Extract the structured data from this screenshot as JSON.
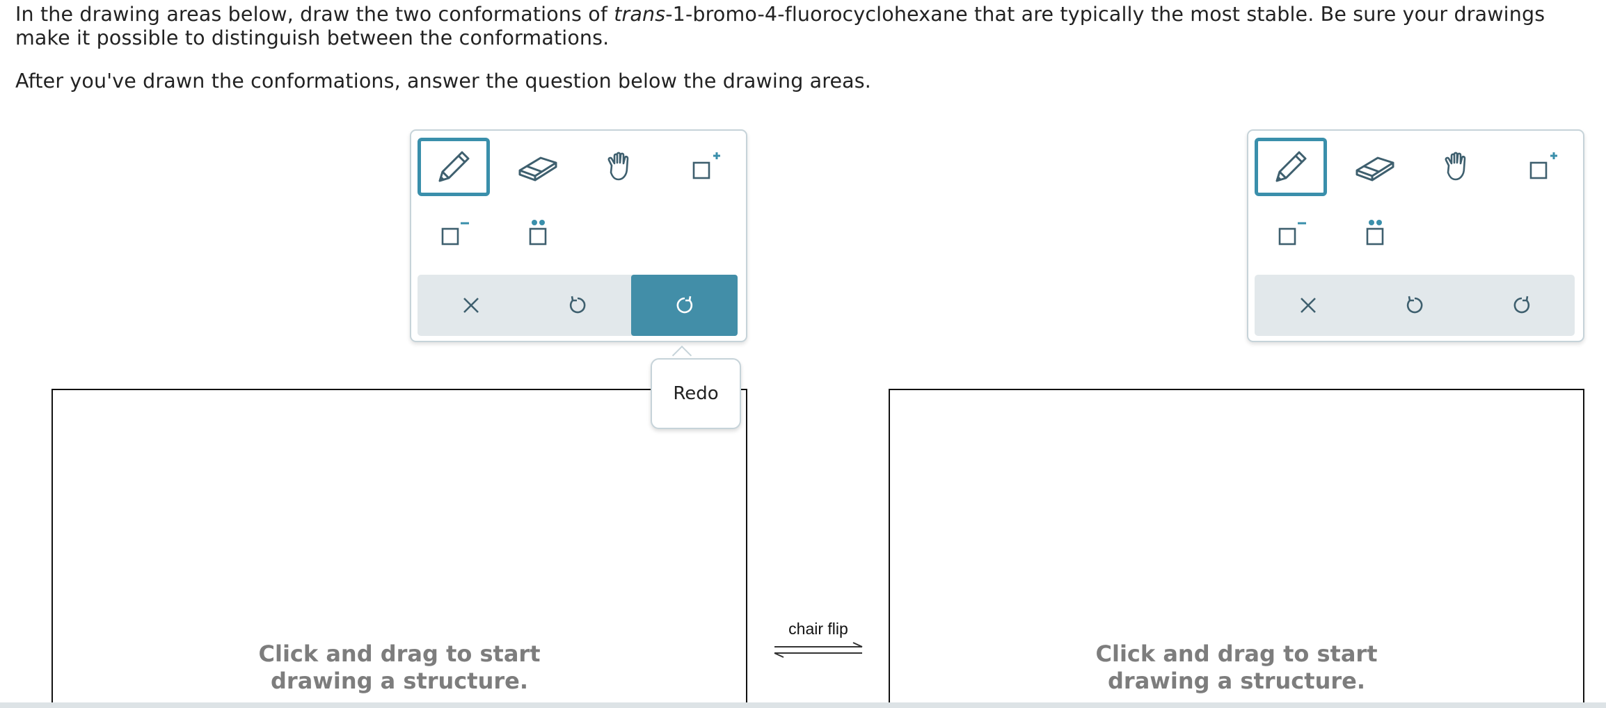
{
  "instructions": {
    "line1_prefix": "In the drawing areas below, draw the two conformations of ",
    "line1_italic": "trans",
    "line1_suffix": "-1-bromo-4-fluorocyclohexane that are typically the most stable. Be sure your drawings make it possible to distinguish between the conformations.",
    "line2": "After you've drawn the conformations, answer the question below the drawing areas."
  },
  "toolbar": {
    "tools": [
      {
        "name": "pencil",
        "icon": "pencil-icon",
        "selected": true
      },
      {
        "name": "eraser",
        "icon": "eraser-icon",
        "selected": false
      },
      {
        "name": "move",
        "icon": "hand-icon",
        "selected": false
      },
      {
        "name": "positive-charge",
        "icon": "positive-charge-icon",
        "selected": false
      },
      {
        "name": "negative-charge",
        "icon": "negative-charge-icon",
        "selected": false
      },
      {
        "name": "lone-pair",
        "icon": "lone-pair-icon",
        "selected": false
      }
    ],
    "actions": [
      {
        "name": "clear",
        "icon": "close-icon"
      },
      {
        "name": "undo",
        "icon": "undo-icon"
      },
      {
        "name": "redo",
        "icon": "redo-icon"
      }
    ]
  },
  "tooltip": {
    "text": "Redo"
  },
  "drawing_areas": [
    {
      "placeholder_line1": "Click and drag to start",
      "placeholder_line2": "drawing a structure."
    },
    {
      "placeholder_line1": "Click and drag to start",
      "placeholder_line2": "drawing a structure."
    }
  ],
  "equilibrium": {
    "label": "chair flip"
  },
  "colors": {
    "accent": "#3a8fab",
    "action_active": "#428ea8",
    "icon": "#3e5f6e",
    "panel_border": "#c6d3d9",
    "action_bar": "#e2e8eb",
    "placeholder": "#7d7d7d"
  }
}
